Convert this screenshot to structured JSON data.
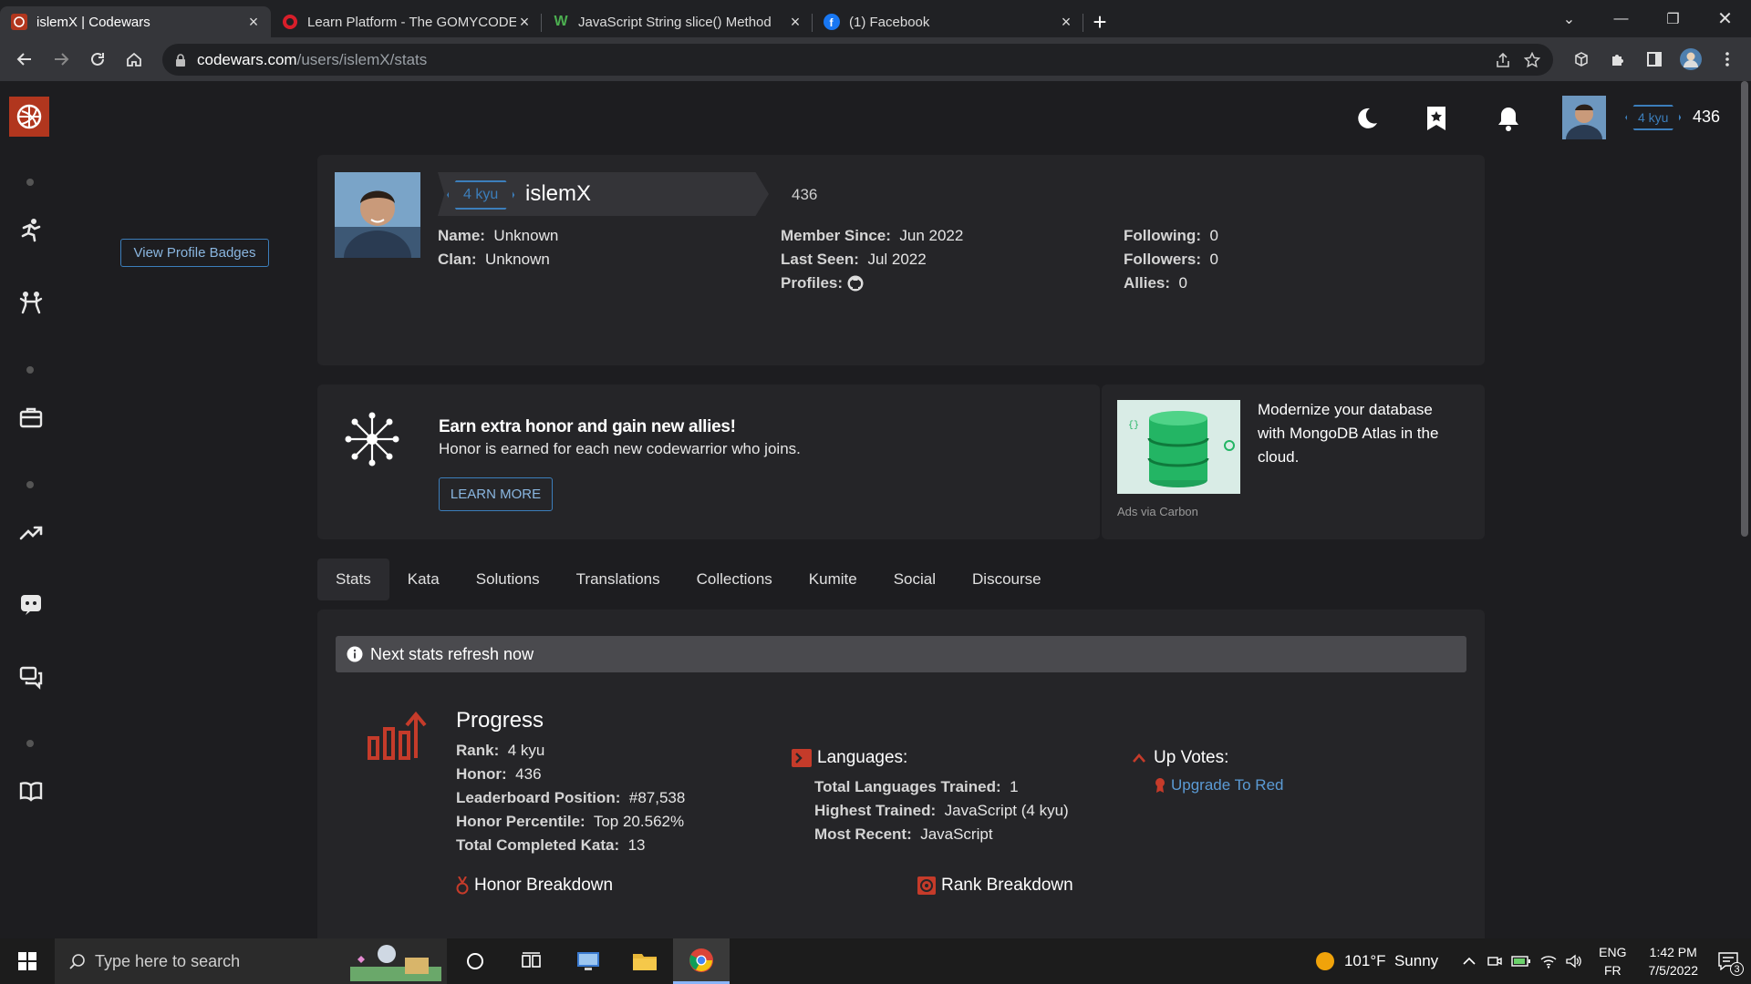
{
  "browser": {
    "tabs": [
      {
        "title": "islemX | Codewars",
        "active": true
      },
      {
        "title": "Learn Platform - The GOMYCODE",
        "active": false
      },
      {
        "title": "JavaScript String slice() Method",
        "active": false
      },
      {
        "title": "(1) Facebook",
        "active": false
      }
    ],
    "url_host": "codewars.com",
    "url_path": "/users/islemX/stats"
  },
  "header": {
    "rank": "4 kyu",
    "honor": "436"
  },
  "profile": {
    "rank": "4 kyu",
    "username": "islemX",
    "honor": "436",
    "name_label": "Name:",
    "name_value": "Unknown",
    "clan_label": "Clan:",
    "clan_value": "Unknown",
    "member_since_label": "Member Since:",
    "member_since_value": "Jun 2022",
    "last_seen_label": "Last Seen:",
    "last_seen_value": "Jul 2022",
    "profiles_label": "Profiles:",
    "following_label": "Following:",
    "following_value": "0",
    "followers_label": "Followers:",
    "followers_value": "0",
    "allies_label": "Allies:",
    "allies_value": "0",
    "badges_button": "View Profile Badges"
  },
  "promo": {
    "title": "Earn extra honor and gain new allies!",
    "text": "Honor is earned for each new codewarrior who joins.",
    "button": "LEARN MORE"
  },
  "ad": {
    "text": "Modernize your database with MongoDB Atlas in the cloud.",
    "via": "Ads via Carbon"
  },
  "tabs": [
    "Stats",
    "Kata",
    "Solutions",
    "Translations",
    "Collections",
    "Kumite",
    "Social",
    "Discourse"
  ],
  "stats": {
    "refresh_notice": "Next stats refresh now",
    "progress_title": "Progress",
    "rank_label": "Rank:",
    "rank_value": "4 kyu",
    "honor_label": "Honor:",
    "honor_value": "436",
    "leaderboard_label": "Leaderboard Position:",
    "leaderboard_value": "#87,538",
    "percentile_label": "Honor Percentile:",
    "percentile_value": "Top 20.562%",
    "completed_label": "Total Completed Kata:",
    "completed_value": "13",
    "languages_title": "Languages:",
    "total_languages_label": "Total Languages Trained:",
    "total_languages_value": "1",
    "highest_label": "Highest Trained:",
    "highest_value": "JavaScript (4 kyu)",
    "recent_label": "Most Recent:",
    "recent_value": "JavaScript",
    "upvotes_title": "Up Votes:",
    "upgrade_link": "Upgrade To Red",
    "honor_breakdown": "Honor Breakdown",
    "rank_breakdown": "Rank Breakdown"
  },
  "taskbar": {
    "search_placeholder": "Type here to search",
    "weather": "101°F  Sunny",
    "lang_top": "ENG",
    "lang_bottom": "FR",
    "time": "1:42 PM",
    "date": "7/5/2022",
    "notif_count": "3"
  },
  "colors": {
    "accent_blue": "#3c7ebb",
    "codewars_red": "#b1361e",
    "link_blue": "#5b9bd5"
  }
}
